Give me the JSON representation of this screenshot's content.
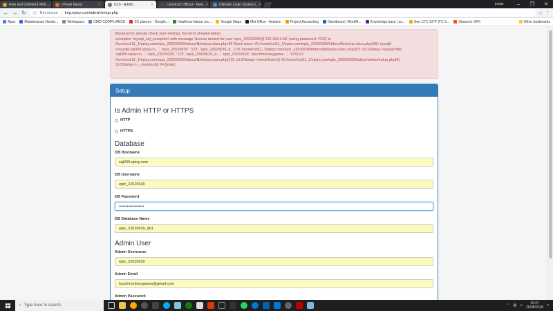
{
  "browser": {
    "user": "Lewis",
    "tabs": [
      {
        "title": "Free and Unlimited Web ...",
        "color": "#e8a03c",
        "active": false
      },
      {
        "title": "cPanel Mysql",
        "color": "#f26b21",
        "active": false
      },
      {
        "title": "ULS - Admin",
        "color": "#777777",
        "active": true
      },
      {
        "title": "Construct Official - New...",
        "color": "#4a4a4a",
        "active": false
      },
      {
        "title": "Ultimate Login System (...",
        "color": "#4a90d9",
        "active": false
      }
    ],
    "not_secure": "Not secure",
    "url": "tmg.epizy.com/admin/setup.php",
    "bookmarks": [
      {
        "label": "Apps",
        "color": "#4285f4"
      },
      {
        "label": "Maintenance Hando...",
        "color": "#3367d6"
      },
      {
        "label": "Workspace",
        "color": "#888888"
      },
      {
        "label": "CMO COMPLIANCE",
        "color": "#5b7fc7"
      },
      {
        "label": "SC planner - Google...",
        "color": "#d93025"
      },
      {
        "label": "Heathrow labour rec...",
        "color": "#2e7d32"
      },
      {
        "label": "Google Maps",
        "color": "#fbbc04"
      },
      {
        "label": "Met Office - Aviation",
        "color": "#1a1a1a"
      },
      {
        "label": "Project Accounting",
        "color": "#f29900"
      },
      {
        "label": "Dashboard | WorkM...",
        "color": "#1565c0"
      },
      {
        "label": "Knowledge base | su...",
        "color": "#6a1b9a"
      },
      {
        "label": "Sun 11°C 52°F 2°C 3...",
        "color": "#f9ab00"
      },
      {
        "label": "Strava to GPX",
        "color": "#fc4c02"
      }
    ],
    "other_bookmarks": "Other bookmarks"
  },
  "alert": {
    "lines": [
      "Mysql Error, please check your settings, full error showed below",
      "exception 'mysqli_sql_exception' with message 'Access denied for user 'epiz_22620639'@'192.168.0.50' (using password: YES)' in",
      "/home/vol11_1/epizy.com/epiz_22620639/htdocs/lib/setup.class.php:96 Stack trace: #0 /home/vol11_1/epizy.com/epiz_22620639/htdocs/lib/setup.class.php(96): mysqli-",
      ">mysqli('sql309.epizy.co...', 'epiz_22620639', '123', 'epiz_22620639_d...') #1 /home/vol11_1/epizy.com/epiz_22620639/htdocs/lib/setup.class.php(57): ULS\\Setup->setup('http',",
      "'sql309.epizy.co...', 'epiz_22620639', '123', 'epiz_22620639_d...', 'epiz_22620639', 'touchmonkeygame...', '123') #2",
      "/home/vol11_1/epizy.com/epiz_22620639/htdocs/lib/setup.class.php(10): ULS\\Setup->checkAction() #3 /home/vol11_1/epizy.com/epiz_22620639/htdocs/admin/setup.php(6):",
      "ULS\\Setup->__construct() #4 {main}"
    ]
  },
  "panel": {
    "title": "Setup",
    "protocol_heading": "Is Admin HTTP or HTTPS",
    "option_http": "HTTP",
    "option_https": "HTTPS",
    "database_heading": "Database",
    "db_hostname_label": "DB Hostname",
    "db_hostname_value": "sql309.epizy.com",
    "db_username_label": "DB Username",
    "db_username_value": "epiz_22620639",
    "db_password_label": "DB Password",
    "db_password_value": "•••••••••••••••••••",
    "db_name_label": "DB Database Name",
    "db_name_value": "epiz_22620639_db1",
    "admin_heading": "Admin User",
    "admin_username_label": "Admin Username",
    "admin_username_value": "epiz_22620639",
    "admin_email_label": "Admin Email",
    "admin_email_value": "touchmonkeygames@gmail.com",
    "admin_password_label": "Admin Password"
  },
  "taskbar": {
    "search_placeholder": "Type here to search",
    "time": "19:37",
    "date": "26/08/2018"
  }
}
